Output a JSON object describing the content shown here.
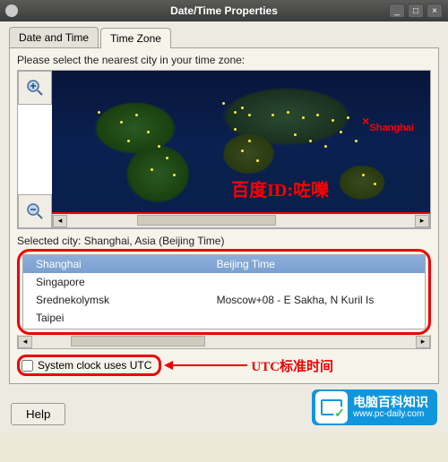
{
  "window": {
    "title": "Date/Time Properties"
  },
  "tabs": {
    "date_time": "Date and Time",
    "time_zone": "Time Zone"
  },
  "instruction": "Please select the nearest city in your time zone:",
  "map": {
    "marked_city": "Shanghai",
    "watermark": "百度ID:咗嚛"
  },
  "selected_city_label": "Selected city: Shanghai, Asia (Beijing Time)",
  "city_list": [
    {
      "name": "Shanghai",
      "tz": "Beijing Time",
      "selected": true
    },
    {
      "name": "Singapore",
      "tz": "",
      "selected": false
    },
    {
      "name": "Srednekolymsk",
      "tz": "Moscow+08 - E Sakha, N Kuril Is",
      "selected": false
    },
    {
      "name": "Taipei",
      "tz": "",
      "selected": false
    }
  ],
  "utc": {
    "label": "System clock uses UTC",
    "checked": false
  },
  "annotation": {
    "utc_note": "UTC标准时间"
  },
  "footer": {
    "help": "Help"
  },
  "badge": {
    "cn": "电脑百科知识",
    "url": "www.pc-daily.com"
  }
}
